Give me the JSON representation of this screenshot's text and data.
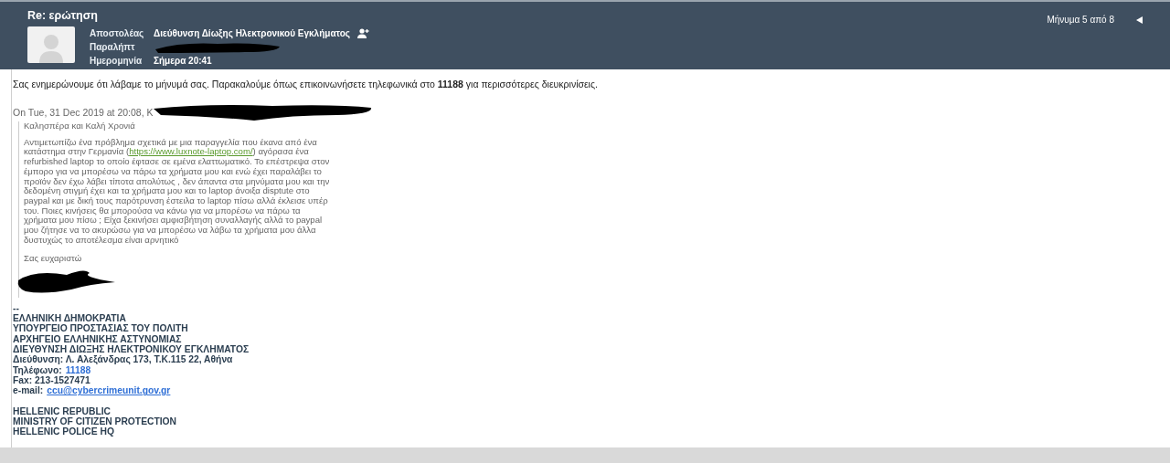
{
  "header": {
    "title": "Re: ερώτηση",
    "fields": [
      {
        "label": "Αποστολέας",
        "value": "Διεύθυνση Δίωξης Ηλεκτρονικού Εγκλήματος",
        "kind": "sender",
        "redacted": false
      },
      {
        "label": "Παραλήπτ",
        "kind": "plain",
        "redacted": true
      },
      {
        "label": "Ημερομηνία",
        "value": "Σήμερα 20:41",
        "kind": "plain",
        "redacted": false
      }
    ],
    "counter": "Μήνυμα 5 από 8"
  },
  "body": {
    "reply": "Σας ενημερώνουμε ότι λάβαμε το μήνυμά σας. Παρακαλούμε όπως επικοινωνήσετε τηλεφωνικά στο **11188** για περισσότερες διευκρινίσεις.",
    "quote_header": "On Tue, 31 Dec 2019 at 20:08, K",
    "quote": {
      "greeting": "Καλησπέρα και Καλή Χρονιά",
      "text_before_link": "Αντιμετωπίζω ένα πρόβλημα σχετικά με μια παραγγελία που έκανα από ένα κατάστημα στην Γερμανία (",
      "link": "https://www.luxnote-laptop.com/",
      "text_after_link": ") αγόρασα ένα refurbished laptop το οποίο έφτασε σε εμένα ελαττωματικό. Το επέστρεψα στον έμπορο  για να μπορέσω να πάρω τα χρήματα μου και ενώ έχει παραλάβει το προϊόν δεν έχω λάβει τίποτα απολύτως , δεν άπαντα στα μηνύματα μου και την δεδομένη στιγμή έχει και τα χρήματα μου  και το laptop άνοιξα disptute στο paypal και με δική τους παρότρυνση έστειλα το laptop πίσω αλλά έκλεισε υπέρ του. Ποιες κινήσεις θα μπορούσα να κάνω για να μπορέσω να πάρω τα χρήματα μου πίσω ; Είχα ξεκινήσει αμφισβήτηση συναλλαγής αλλά το paypal μου ζήτησε να το ακυρώσω για να μπορέσω να λάβω τα χρήματα μου άλλα δυστυχώς το αποτέλεσμα είναι αρνητικό",
      "thanks": "Σας ευχαριστώ"
    },
    "signature": {
      "separator": "--",
      "lines": [
        {
          "text": "ΕΛΛΗΝΙΚΗ ΔΗΜΟΚΡΑΤΙΑ",
          "kind": "plain"
        },
        {
          "text": "ΥΠΟΥΡΓΕΙΟ ΠΡΟΣΤΑΣΙΑΣ ΤΟΥ ΠΟΛΙΤΗ",
          "kind": "plain"
        },
        {
          "text": "ΑΡΧΗΓΕΙΟ ΕΛΛΗΝΙΚΗΣ ΑΣΤΥΝΟΜΙΑΣ",
          "kind": "plain"
        },
        {
          "text": "ΔΙΕΥΘΥΝΣΗ ΔΙΩΞΗΣ ΗΛΕΚΤΡΟΝΙΚΟΥ ΕΓΚΛΗΜΑΤΟΣ",
          "kind": "plain"
        },
        {
          "text": "Διεύθυνση: Λ. Αλεξάνδρας 173, Τ.Κ.115 22, Αθήνα",
          "kind": "plain"
        },
        {
          "text": "Τηλέφωνο:",
          "value": "11188",
          "kind": "phone"
        },
        {
          "text": "Fax: 213-1527471",
          "kind": "plain"
        },
        {
          "text": "e-mail:",
          "value": "ccu@cybercrimeunit.gov.gr",
          "kind": "email"
        },
        {
          "kind": "gap"
        },
        {
          "text": "HELLENIC REPUBLIC",
          "kind": "plain"
        },
        {
          "text": "MINISTRY OF CITIZEN PROTECTION",
          "kind": "plain"
        },
        {
          "text": "HELLENIC POLICE HQ",
          "kind": "plain"
        }
      ]
    }
  }
}
